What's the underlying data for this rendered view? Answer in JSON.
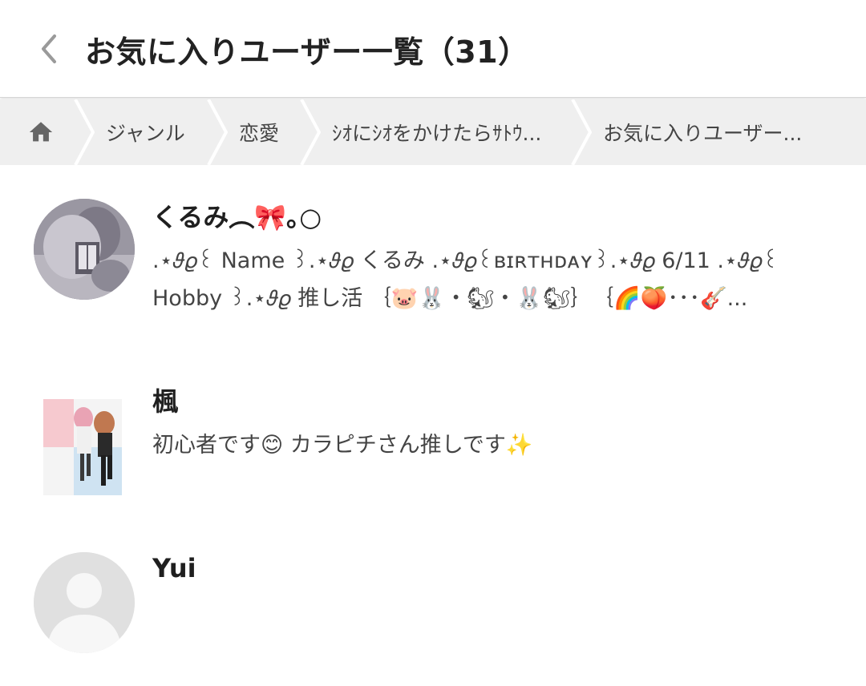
{
  "header": {
    "title": "お気に入りユーザー一覧（31）",
    "back_icon": "chevron-left-icon"
  },
  "breadcrumb": {
    "home_icon": "home-icon",
    "items": [
      {
        "label": "ジャンル"
      },
      {
        "label": "恋愛"
      },
      {
        "label": "ｼｵにｼｵをかけたらｻﾄｳ..."
      },
      {
        "label": "お気に入りユーザー..."
      }
    ]
  },
  "users": [
    {
      "name": "くるみ︵🎀｡○",
      "bio_lines": [
        ".⋆𝜗𝜚꒰ Name ꒱.⋆𝜗𝜚 くるみ .⋆𝜗𝜚꒰ʙɪʀᴛʜᴅᴀʏ꒱.⋆𝜗𝜚 6/11 .⋆𝜗𝜚꒰",
        "Hobby ꒱.⋆𝜗𝜚 推し活 ｛🐷🐰・🐿・🐰🐿｝　｛🌈🍑･･･🎸..."
      ]
    },
    {
      "name": "楓",
      "bio_lines": [
        "初心者です😊 カラピチさん推しです✨"
      ]
    },
    {
      "name": "Yui",
      "bio_lines": []
    }
  ],
  "colors": {
    "breadcrumb_bg": "#efefef",
    "breadcrumb_sep": "#ffffff",
    "avatar_placeholder": "#e0e0e0"
  }
}
